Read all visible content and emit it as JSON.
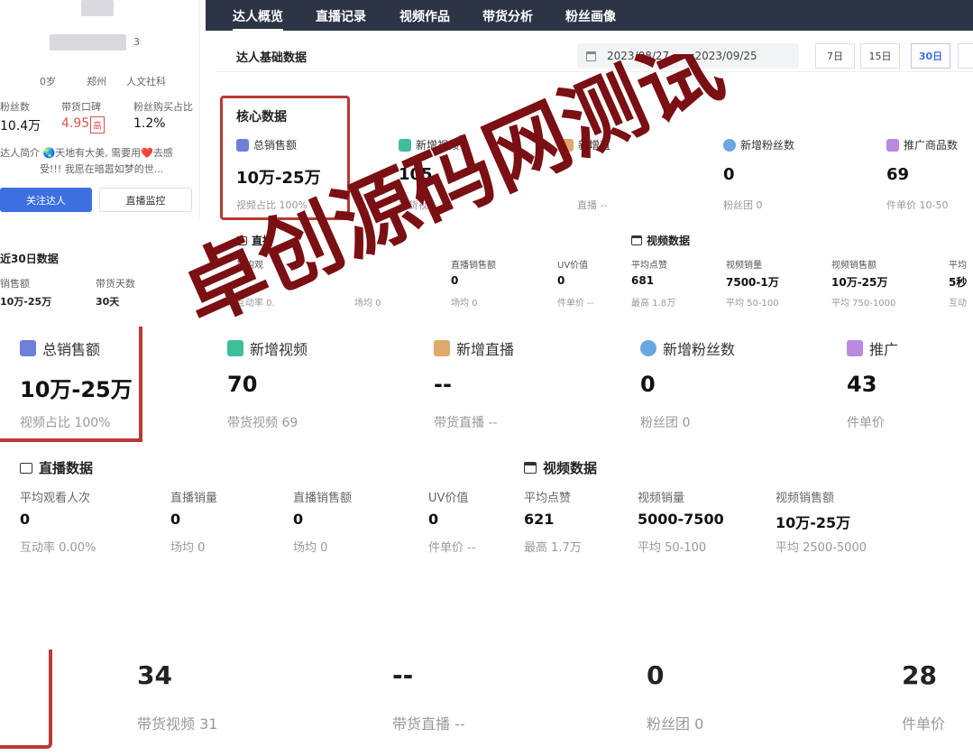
{
  "nav": {
    "tabs": [
      "达人概览",
      "直播记录",
      "视频作品",
      "带货分析",
      "粉丝画像"
    ]
  },
  "profile": {
    "id_suffix": "3",
    "age": "0岁",
    "city": "郑州",
    "category": "人文社科",
    "stats": [
      {
        "label": "粉丝数",
        "value": "10.4万"
      },
      {
        "label": "带货口碑",
        "value": "4.95",
        "badge": "高"
      },
      {
        "label": "粉丝购买占比",
        "value": "1.2%"
      }
    ],
    "intro_line1": "达人简介 🌏天地有大美, 需要用❤️去感",
    "intro_line2": "受!!! 我愿在暗嚣如梦的世...",
    "follow_button": "关注达人",
    "monitor_button": "直播监控"
  },
  "recent30": {
    "title": "近30日数据",
    "items": [
      {
        "label": "销售额",
        "value": "10万-25万"
      },
      {
        "label": "带货天数",
        "value": "30天"
      }
    ]
  },
  "header": {
    "title": "达人基础数据",
    "date_start": "2023/08/27",
    "date_sep": "-",
    "date_end": "2023/09/25",
    "ranges": [
      "7日",
      "15日",
      "30日"
    ]
  },
  "core": {
    "title": "核心数据",
    "metrics": [
      {
        "label": "总销售额",
        "value": "10万-25万",
        "sub": "视频占比 100%"
      },
      {
        "label": "新增视频",
        "value": "105",
        "sub": "带货视"
      },
      {
        "label": "新增直",
        "value": "",
        "sub": "直播 --"
      },
      {
        "label": "新增粉丝数",
        "value": "0",
        "sub": "粉丝团 0"
      },
      {
        "label": "推广商品数",
        "value": "69",
        "sub": "件单价 10-50"
      }
    ],
    "live_title": "直播",
    "live": [
      {
        "label": "平均观",
        "value": "",
        "sub": "互动率 0."
      },
      {
        "label": "",
        "value": "",
        "sub": "场均 0"
      },
      {
        "label": "直播销售额",
        "value": "0",
        "sub": "场均 0"
      },
      {
        "label": "UV价值",
        "value": "0",
        "sub": "件单价 --"
      }
    ],
    "video_title": "视频数据",
    "video": [
      {
        "label": "平均点赞",
        "value": "681",
        "sub": "最高 1.8万"
      },
      {
        "label": "视频销量",
        "value": "7500-1万",
        "sub": "平均 50-100"
      },
      {
        "label": "视频销售额",
        "value": "10万-25万",
        "sub": "平均 750-1000"
      },
      {
        "label": "平均",
        "value": "5秒",
        "sub": "互动"
      }
    ]
  },
  "section2": {
    "metrics": [
      {
        "label": "总销售额",
        "value": "10万-25万",
        "sub": "视频占比 100%"
      },
      {
        "label": "新增视频",
        "value": "70",
        "sub": "带货视频 69"
      },
      {
        "label": "新增直播",
        "value": "--",
        "sub": "带货直播 --"
      },
      {
        "label": "新增粉丝数",
        "value": "0",
        "sub": "粉丝团 0"
      },
      {
        "label": "推广",
        "value": "43",
        "sub": "件单价"
      }
    ],
    "live_title": "直播数据",
    "live": [
      {
        "label": "平均观看人次",
        "value": "0",
        "sub": "互动率 0.00%"
      },
      {
        "label": "直播销量",
        "value": "0",
        "sub": "场均 0"
      },
      {
        "label": "直播销售额",
        "value": "0",
        "sub": "场均 0"
      },
      {
        "label": "UV价值",
        "value": "0",
        "sub": "件单价 --"
      }
    ],
    "video_title": "视频数据",
    "video": [
      {
        "label": "平均点赞",
        "value": "621",
        "sub": "最高 1.7万"
      },
      {
        "label": "视频销量",
        "value": "5000-7500",
        "sub": "平均 50-100"
      },
      {
        "label": "视频销售额",
        "value": "10万-25万",
        "sub": "平均 2500-5000"
      }
    ]
  },
  "section3": {
    "metrics": [
      {
        "value": "34",
        "sub": "带货视频 31"
      },
      {
        "value": "--",
        "sub": "带货直播 --"
      },
      {
        "value": "0",
        "sub": "粉丝团 0"
      },
      {
        "value": "28",
        "sub": "件单价"
      }
    ]
  },
  "watermark": {
    "text": "卓创源码网测试",
    "color": "#7a0f14"
  },
  "colors": {
    "accent": "#3d6fe0",
    "nav_bg": "#2c3446",
    "highlight": "#b73a35",
    "badge_red": "#d9534f"
  },
  "icons": {
    "sales": "sales-icon",
    "video": "video-icon",
    "live": "live-icon",
    "fans": "fans-icon",
    "goods": "goods-icon",
    "calendar": "calendar-icon"
  }
}
